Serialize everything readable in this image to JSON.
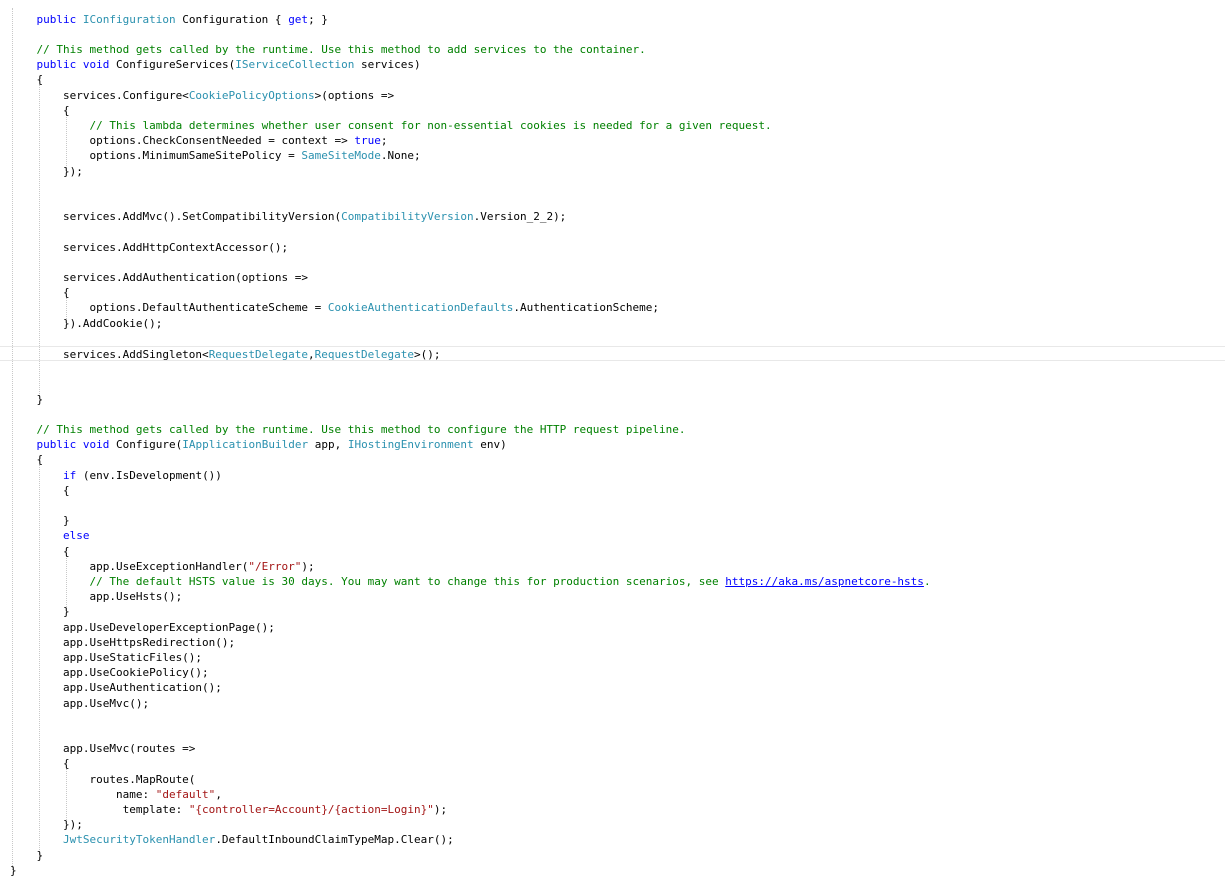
{
  "colors": {
    "background": "#ffffff",
    "plain": "#000000",
    "keyword": "#0000ff",
    "type": "#2b91af",
    "comment": "#008000",
    "string": "#a31515",
    "link": "#0000ff"
  },
  "lines": [
    [
      [
        "    ",
        "p"
      ],
      [
        "public",
        "kw"
      ],
      [
        " ",
        "p"
      ],
      [
        "IConfiguration",
        "ty"
      ],
      [
        " Configuration { ",
        "p"
      ],
      [
        "get",
        "kw"
      ],
      [
        "; }",
        "p"
      ]
    ],
    [],
    [
      [
        "    ",
        "p"
      ],
      [
        "// This method gets called by the runtime. Use this method to add services to the container.",
        "cm"
      ]
    ],
    [
      [
        "    ",
        "p"
      ],
      [
        "public",
        "kw"
      ],
      [
        " ",
        "p"
      ],
      [
        "void",
        "kw"
      ],
      [
        " ConfigureServices(",
        "p"
      ],
      [
        "IServiceCollection",
        "ty"
      ],
      [
        " services)",
        "p"
      ]
    ],
    [
      [
        "    {",
        "p"
      ]
    ],
    [
      [
        "        services.Configure<",
        "p"
      ],
      [
        "CookiePolicyOptions",
        "ty"
      ],
      [
        ">(options =>",
        "p"
      ]
    ],
    [
      [
        "        {",
        "p"
      ]
    ],
    [
      [
        "            ",
        "p"
      ],
      [
        "// This lambda determines whether user consent for non-essential cookies is needed for a given request.",
        "cm"
      ]
    ],
    [
      [
        "            options.CheckConsentNeeded = context => ",
        "p"
      ],
      [
        "true",
        "kw"
      ],
      [
        ";",
        "p"
      ]
    ],
    [
      [
        "            options.MinimumSameSitePolicy = ",
        "p"
      ],
      [
        "SameSiteMode",
        "ty"
      ],
      [
        ".None;",
        "p"
      ]
    ],
    [
      [
        "        });",
        "p"
      ]
    ],
    [],
    [],
    [
      [
        "        services.AddMvc().SetCompatibilityVersion(",
        "p"
      ],
      [
        "CompatibilityVersion",
        "ty"
      ],
      [
        ".Version_2_2);",
        "p"
      ]
    ],
    [],
    [
      [
        "        services.AddHttpContextAccessor();",
        "p"
      ]
    ],
    [],
    [
      [
        "        services.AddAuthentication(options =>",
        "p"
      ]
    ],
    [
      [
        "        {",
        "p"
      ]
    ],
    [
      [
        "            options.DefaultAuthenticateScheme = ",
        "p"
      ],
      [
        "CookieAuthenticationDefaults",
        "ty"
      ],
      [
        ".AuthenticationScheme;",
        "p"
      ]
    ],
    [
      [
        "        }).AddCookie();",
        "p"
      ]
    ],
    [],
    [
      [
        "        services.AddSingleton<",
        "p"
      ],
      [
        "RequestDelegate",
        "ty"
      ],
      [
        ",",
        "p"
      ],
      [
        "RequestDelegate",
        "ty"
      ],
      [
        ">();",
        "p"
      ]
    ],
    [],
    [],
    [
      [
        "    }",
        "p"
      ]
    ],
    [],
    [
      [
        "    ",
        "p"
      ],
      [
        "// This method gets called by the runtime. Use this method to configure the HTTP request pipeline.",
        "cm"
      ]
    ],
    [
      [
        "    ",
        "p"
      ],
      [
        "public",
        "kw"
      ],
      [
        " ",
        "p"
      ],
      [
        "void",
        "kw"
      ],
      [
        " Configure(",
        "p"
      ],
      [
        "IApplicationBuilder",
        "ty"
      ],
      [
        " app, ",
        "p"
      ],
      [
        "IHostingEnvironment",
        "ty"
      ],
      [
        " env)",
        "p"
      ]
    ],
    [
      [
        "    {",
        "p"
      ]
    ],
    [
      [
        "        ",
        "p"
      ],
      [
        "if",
        "kw"
      ],
      [
        " (env.IsDevelopment())",
        "p"
      ]
    ],
    [
      [
        "        {",
        "p"
      ]
    ],
    [],
    [
      [
        "        }",
        "p"
      ]
    ],
    [
      [
        "        ",
        "p"
      ],
      [
        "else",
        "kw"
      ]
    ],
    [
      [
        "        {",
        "p"
      ]
    ],
    [
      [
        "            app.UseExceptionHandler(",
        "p"
      ],
      [
        "\"/Error\"",
        "st"
      ],
      [
        ");",
        "p"
      ]
    ],
    [
      [
        "            ",
        "p"
      ],
      [
        "// The default HSTS value is 30 days. You may want to change this for production scenarios, see ",
        "cm"
      ],
      [
        "https://aka.ms/aspnetcore-hsts",
        "lk"
      ],
      [
        ".",
        "cm"
      ]
    ],
    [
      [
        "            app.UseHsts();",
        "p"
      ]
    ],
    [
      [
        "        }",
        "p"
      ]
    ],
    [
      [
        "        app.UseDeveloperExceptionPage();",
        "p"
      ]
    ],
    [
      [
        "        app.UseHttpsRedirection();",
        "p"
      ]
    ],
    [
      [
        "        app.UseStaticFiles();",
        "p"
      ]
    ],
    [
      [
        "        app.UseCookiePolicy();",
        "p"
      ]
    ],
    [
      [
        "        app.UseAuthentication();",
        "p"
      ]
    ],
    [
      [
        "        app.UseMvc();",
        "p"
      ]
    ],
    [],
    [],
    [
      [
        "        app.UseMvc(routes =>",
        "p"
      ]
    ],
    [
      [
        "        {",
        "p"
      ]
    ],
    [
      [
        "            routes.MapRoute(",
        "p"
      ]
    ],
    [
      [
        "                name: ",
        "p"
      ],
      [
        "\"default\"",
        "st"
      ],
      [
        ",",
        "p"
      ]
    ],
    [
      [
        "                 template: ",
        "p"
      ],
      [
        "\"{controller=Account}/{action=Login}\"",
        "st"
      ],
      [
        ");",
        "p"
      ]
    ],
    [
      [
        "        });",
        "p"
      ]
    ],
    [
      [
        "        ",
        "p"
      ],
      [
        "JwtSecurityTokenHandler",
        "ty"
      ],
      [
        ".DefaultInboundClaimTypeMap.Clear();",
        "p"
      ]
    ],
    [
      [
        "    }",
        "p"
      ]
    ],
    [
      [
        "}",
        "p"
      ]
    ]
  ]
}
